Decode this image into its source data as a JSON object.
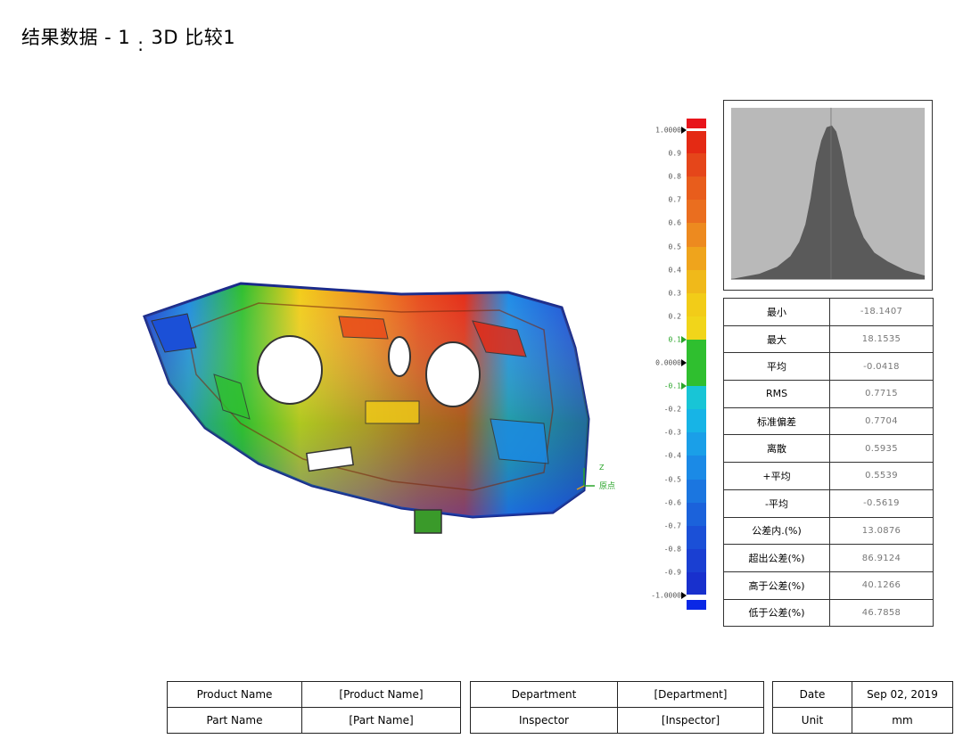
{
  "title": {
    "text": "结果数据 - 1",
    "separator": ":",
    "subtitle": "3D 比较1"
  },
  "legend": {
    "ticks": [
      "1.0000",
      "0.9",
      "0.8",
      "0.7",
      "0.6",
      "0.5",
      "0.4",
      "0.3",
      "0.2",
      "0.1",
      "0.0000",
      "-0.1",
      "-0.2",
      "-0.3",
      "-0.4",
      "-0.5",
      "-0.6",
      "-0.7",
      "-0.8",
      "-0.9",
      "-1.0000"
    ],
    "green_ticks": [
      "0.1",
      "-0.1"
    ],
    "range": [
      -1.0,
      1.0
    ],
    "colors": {
      "high": "#e8141b",
      "low": "#0a28e6",
      "in_tolerance": "#2fbf2f",
      "bands": [
        "#e42a14",
        "#e5461a",
        "#e85d1c",
        "#ea6e1f",
        "#ed8a1f",
        "#efa41c",
        "#f0b91a",
        "#f2cc18",
        "#f1d51a",
        "#2fbf2f",
        "#2fbf2f",
        "#18c5d6",
        "#17b4e6",
        "#1a9fe8",
        "#1b8ae6",
        "#1b76e0",
        "#1b62db",
        "#1b50d7",
        "#1a3fd2",
        "#1830cd"
      ]
    }
  },
  "axis_label": "原点",
  "axis_z": "Z",
  "stats": [
    {
      "label": "最小",
      "value": "-18.1407"
    },
    {
      "label": "最大",
      "value": "18.1535"
    },
    {
      "label": "平均",
      "value": "-0.0418"
    },
    {
      "label": "RMS",
      "value": "0.7715"
    },
    {
      "label": "标准偏差",
      "value": "0.7704"
    },
    {
      "label": "离散",
      "value": "0.5935"
    },
    {
      "label": "+平均",
      "value": "0.5539"
    },
    {
      "label": "-平均",
      "value": "-0.5619"
    },
    {
      "label": "公差内.(%)",
      "value": "13.0876"
    },
    {
      "label": "超出公差(%)",
      "value": "86.9124"
    },
    {
      "label": "高于公差(%)",
      "value": "40.1266"
    },
    {
      "label": "低于公差(%)",
      "value": "46.7858"
    }
  ],
  "info": {
    "product_name_label": "Product Name",
    "product_name_value": "[Product Name]",
    "part_name_label": "Part Name",
    "part_name_value": "[Part Name]",
    "department_label": "Department",
    "department_value": "[Department]",
    "inspector_label": "Inspector",
    "inspector_value": "[Inspector]",
    "date_label": "Date",
    "date_value": "Sep 02, 2019",
    "unit_label": "Unit",
    "unit_value": "mm"
  },
  "histogram_colors": {
    "fill": "#5a5a5a",
    "background": "#b9b9b9"
  }
}
